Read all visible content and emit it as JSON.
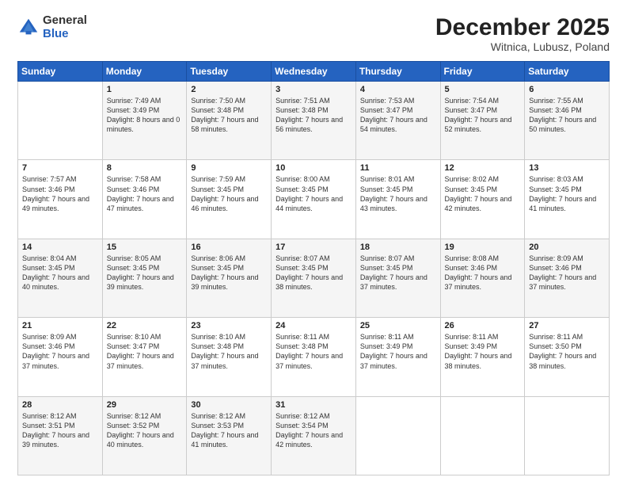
{
  "logo": {
    "general": "General",
    "blue": "Blue"
  },
  "header": {
    "month": "December 2025",
    "location": "Witnica, Lubusz, Poland"
  },
  "weekdays": [
    "Sunday",
    "Monday",
    "Tuesday",
    "Wednesday",
    "Thursday",
    "Friday",
    "Saturday"
  ],
  "weeks": [
    [
      {
        "day": "",
        "sunrise": "",
        "sunset": "",
        "daylight": ""
      },
      {
        "day": "1",
        "sunrise": "Sunrise: 7:49 AM",
        "sunset": "Sunset: 3:49 PM",
        "daylight": "Daylight: 8 hours and 0 minutes."
      },
      {
        "day": "2",
        "sunrise": "Sunrise: 7:50 AM",
        "sunset": "Sunset: 3:48 PM",
        "daylight": "Daylight: 7 hours and 58 minutes."
      },
      {
        "day": "3",
        "sunrise": "Sunrise: 7:51 AM",
        "sunset": "Sunset: 3:48 PM",
        "daylight": "Daylight: 7 hours and 56 minutes."
      },
      {
        "day": "4",
        "sunrise": "Sunrise: 7:53 AM",
        "sunset": "Sunset: 3:47 PM",
        "daylight": "Daylight: 7 hours and 54 minutes."
      },
      {
        "day": "5",
        "sunrise": "Sunrise: 7:54 AM",
        "sunset": "Sunset: 3:47 PM",
        "daylight": "Daylight: 7 hours and 52 minutes."
      },
      {
        "day": "6",
        "sunrise": "Sunrise: 7:55 AM",
        "sunset": "Sunset: 3:46 PM",
        "daylight": "Daylight: 7 hours and 50 minutes."
      }
    ],
    [
      {
        "day": "7",
        "sunrise": "Sunrise: 7:57 AM",
        "sunset": "Sunset: 3:46 PM",
        "daylight": "Daylight: 7 hours and 49 minutes."
      },
      {
        "day": "8",
        "sunrise": "Sunrise: 7:58 AM",
        "sunset": "Sunset: 3:46 PM",
        "daylight": "Daylight: 7 hours and 47 minutes."
      },
      {
        "day": "9",
        "sunrise": "Sunrise: 7:59 AM",
        "sunset": "Sunset: 3:45 PM",
        "daylight": "Daylight: 7 hours and 46 minutes."
      },
      {
        "day": "10",
        "sunrise": "Sunrise: 8:00 AM",
        "sunset": "Sunset: 3:45 PM",
        "daylight": "Daylight: 7 hours and 44 minutes."
      },
      {
        "day": "11",
        "sunrise": "Sunrise: 8:01 AM",
        "sunset": "Sunset: 3:45 PM",
        "daylight": "Daylight: 7 hours and 43 minutes."
      },
      {
        "day": "12",
        "sunrise": "Sunrise: 8:02 AM",
        "sunset": "Sunset: 3:45 PM",
        "daylight": "Daylight: 7 hours and 42 minutes."
      },
      {
        "day": "13",
        "sunrise": "Sunrise: 8:03 AM",
        "sunset": "Sunset: 3:45 PM",
        "daylight": "Daylight: 7 hours and 41 minutes."
      }
    ],
    [
      {
        "day": "14",
        "sunrise": "Sunrise: 8:04 AM",
        "sunset": "Sunset: 3:45 PM",
        "daylight": "Daylight: 7 hours and 40 minutes."
      },
      {
        "day": "15",
        "sunrise": "Sunrise: 8:05 AM",
        "sunset": "Sunset: 3:45 PM",
        "daylight": "Daylight: 7 hours and 39 minutes."
      },
      {
        "day": "16",
        "sunrise": "Sunrise: 8:06 AM",
        "sunset": "Sunset: 3:45 PM",
        "daylight": "Daylight: 7 hours and 39 minutes."
      },
      {
        "day": "17",
        "sunrise": "Sunrise: 8:07 AM",
        "sunset": "Sunset: 3:45 PM",
        "daylight": "Daylight: 7 hours and 38 minutes."
      },
      {
        "day": "18",
        "sunrise": "Sunrise: 8:07 AM",
        "sunset": "Sunset: 3:45 PM",
        "daylight": "Daylight: 7 hours and 37 minutes."
      },
      {
        "day": "19",
        "sunrise": "Sunrise: 8:08 AM",
        "sunset": "Sunset: 3:46 PM",
        "daylight": "Daylight: 7 hours and 37 minutes."
      },
      {
        "day": "20",
        "sunrise": "Sunrise: 8:09 AM",
        "sunset": "Sunset: 3:46 PM",
        "daylight": "Daylight: 7 hours and 37 minutes."
      }
    ],
    [
      {
        "day": "21",
        "sunrise": "Sunrise: 8:09 AM",
        "sunset": "Sunset: 3:46 PM",
        "daylight": "Daylight: 7 hours and 37 minutes."
      },
      {
        "day": "22",
        "sunrise": "Sunrise: 8:10 AM",
        "sunset": "Sunset: 3:47 PM",
        "daylight": "Daylight: 7 hours and 37 minutes."
      },
      {
        "day": "23",
        "sunrise": "Sunrise: 8:10 AM",
        "sunset": "Sunset: 3:48 PM",
        "daylight": "Daylight: 7 hours and 37 minutes."
      },
      {
        "day": "24",
        "sunrise": "Sunrise: 8:11 AM",
        "sunset": "Sunset: 3:48 PM",
        "daylight": "Daylight: 7 hours and 37 minutes."
      },
      {
        "day": "25",
        "sunrise": "Sunrise: 8:11 AM",
        "sunset": "Sunset: 3:49 PM",
        "daylight": "Daylight: 7 hours and 37 minutes."
      },
      {
        "day": "26",
        "sunrise": "Sunrise: 8:11 AM",
        "sunset": "Sunset: 3:49 PM",
        "daylight": "Daylight: 7 hours and 38 minutes."
      },
      {
        "day": "27",
        "sunrise": "Sunrise: 8:11 AM",
        "sunset": "Sunset: 3:50 PM",
        "daylight": "Daylight: 7 hours and 38 minutes."
      }
    ],
    [
      {
        "day": "28",
        "sunrise": "Sunrise: 8:12 AM",
        "sunset": "Sunset: 3:51 PM",
        "daylight": "Daylight: 7 hours and 39 minutes."
      },
      {
        "day": "29",
        "sunrise": "Sunrise: 8:12 AM",
        "sunset": "Sunset: 3:52 PM",
        "daylight": "Daylight: 7 hours and 40 minutes."
      },
      {
        "day": "30",
        "sunrise": "Sunrise: 8:12 AM",
        "sunset": "Sunset: 3:53 PM",
        "daylight": "Daylight: 7 hours and 41 minutes."
      },
      {
        "day": "31",
        "sunrise": "Sunrise: 8:12 AM",
        "sunset": "Sunset: 3:54 PM",
        "daylight": "Daylight: 7 hours and 42 minutes."
      },
      {
        "day": "",
        "sunrise": "",
        "sunset": "",
        "daylight": ""
      },
      {
        "day": "",
        "sunrise": "",
        "sunset": "",
        "daylight": ""
      },
      {
        "day": "",
        "sunrise": "",
        "sunset": "",
        "daylight": ""
      }
    ]
  ]
}
